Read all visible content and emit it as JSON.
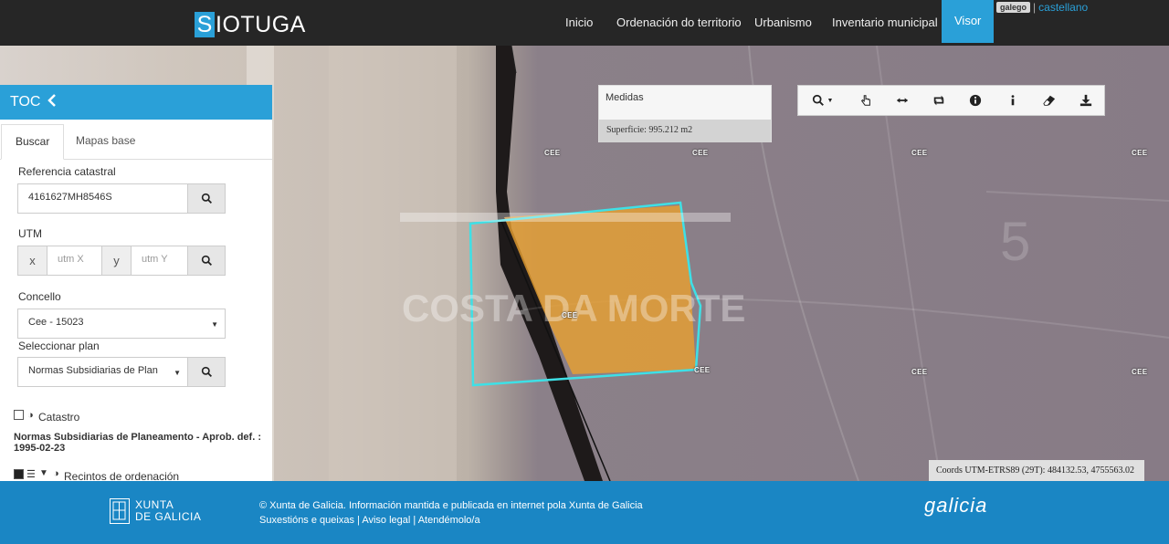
{
  "app": {
    "logo_letter": "S",
    "logo_rest": "IOTUGA"
  },
  "nav": {
    "items": [
      {
        "label": "Inicio"
      },
      {
        "label": "Ordenación do territorio"
      },
      {
        "label": "Urbanismo"
      },
      {
        "label": "Inventario municipal"
      },
      {
        "label": "Visor"
      }
    ],
    "active": "Visor"
  },
  "lang": {
    "current": "galego",
    "separator": "|",
    "other": "castellano"
  },
  "map": {
    "cee_labels": [
      "CEE",
      "CEE",
      "CEE",
      "CEE",
      "CEE",
      "CEE",
      "CEE",
      "CEE",
      "CEE"
    ],
    "watermark": "COSTA DA MORTE",
    "selection_color": "#3ee0e6",
    "parcel_color": "#e8a030"
  },
  "medidas": {
    "title": "Medidas",
    "value": "Superficie: 995.212 m2"
  },
  "tools": [
    "zoom-icon",
    "pan-icon",
    "measure-icon",
    "refresh-icon",
    "info-icon",
    "info-small-icon",
    "eraser-icon",
    "download-icon"
  ],
  "coords": {
    "text": "Coords UTM-ETRS89 (29T): 484132.53, 4755563.02"
  },
  "toc": {
    "title": "TOC",
    "tabs": [
      "Buscar",
      "Mapas base"
    ],
    "catastral_label": "Referencia catastral",
    "catastral_value": "4161627MH8546S",
    "utm_label": "UTM",
    "x_addon": "x",
    "x_placeholder": "utm X",
    "y_addon": "y",
    "y_placeholder": "utm Y",
    "concello_label": "Concello",
    "concello_value": "Cee - 15023",
    "plan_label": "Seleccionar plan",
    "plan_value": "Normas Subsidiarias de Plan",
    "catastro_label": "Catastro",
    "plan_title": "Normas Subsidiarias de Planeamento - Aprob. def. : 1995-02-23",
    "recintos_label": "Recintos de ordenación"
  },
  "footer": {
    "xunta_line1": "XUNTA",
    "xunta_line2": "DE GALICIA",
    "copyright": "© Xunta de Galicia. Información mantida e publicada en internet pola Xunta de Galicia",
    "link1": "Suxestións e queixas",
    "link2": "Aviso legal",
    "link3": "Atendémolo/a",
    "separator": "|",
    "brand": "galicia"
  }
}
